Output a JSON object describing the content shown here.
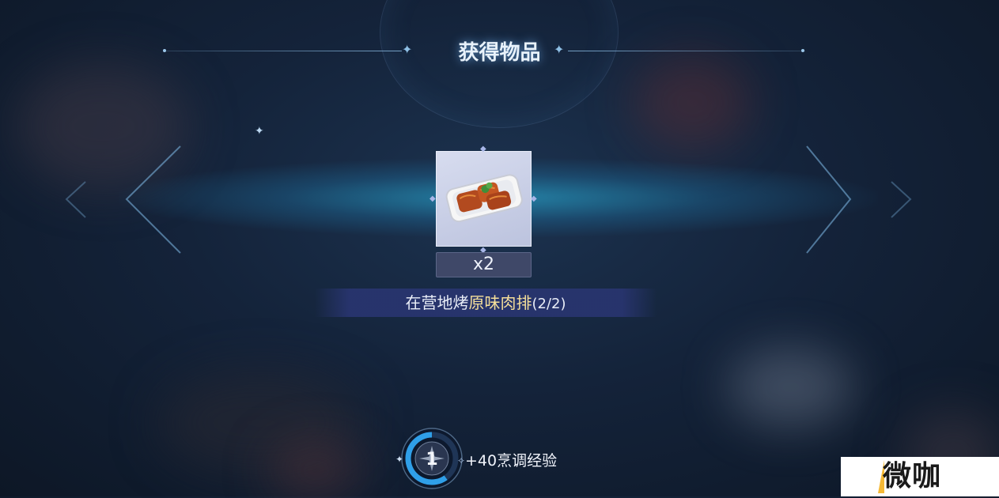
{
  "popup": {
    "title": "获得物品"
  },
  "item": {
    "name": "原味肉排",
    "quantity": "x2",
    "icon": "grilled-meat-plate-icon"
  },
  "task": {
    "prefix": "在营地烤",
    "highlight": "原味肉排",
    "progress": "(2/2)"
  },
  "experience": {
    "level": "1",
    "text": "+40烹调经验",
    "progress_fraction": 0.6
  },
  "watermark": {
    "text": "微咖"
  },
  "colors": {
    "highlight": "#f5df9a",
    "band": "#28aad2",
    "title_glow": "#78beff",
    "exp_arc": "#2f9fe8"
  }
}
